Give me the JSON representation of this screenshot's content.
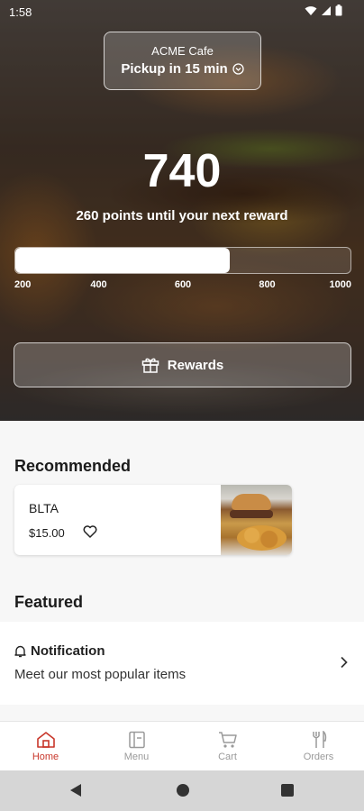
{
  "status_bar": {
    "time": "1:58",
    "icons": [
      "wifi-icon",
      "signal-icon",
      "battery-icon"
    ]
  },
  "store": {
    "name": "ACME Cafe",
    "pickup_label": "Pickup in 15 min",
    "pickup_icon": "chevron-down-circle-icon"
  },
  "points": {
    "value": "740",
    "subtitle": "260 points until your next reward",
    "progress_fraction": 0.64,
    "ticks": [
      "200",
      "400",
      "600",
      "800",
      "1000"
    ]
  },
  "rewards_button": {
    "label": "Rewards",
    "icon": "gift-icon"
  },
  "recommended": {
    "title": "Recommended",
    "items": [
      {
        "name": "BLTA",
        "price": "$15.00",
        "icon": "heart-icon"
      }
    ]
  },
  "featured": {
    "title": "Featured",
    "items": [
      {
        "title": "Notification",
        "description": "Meet our most popular items",
        "icon": "bell-icon"
      }
    ]
  },
  "nav": [
    {
      "label": "Home",
      "icon": "home-icon",
      "active": true
    },
    {
      "label": "Menu",
      "icon": "menu-icon",
      "active": false
    },
    {
      "label": "Cart",
      "icon": "cart-icon",
      "active": false
    },
    {
      "label": "Orders",
      "icon": "utensils-icon",
      "active": false
    }
  ],
  "colors": {
    "accent": "#c8362a",
    "inactive": "#9a9a9a"
  }
}
